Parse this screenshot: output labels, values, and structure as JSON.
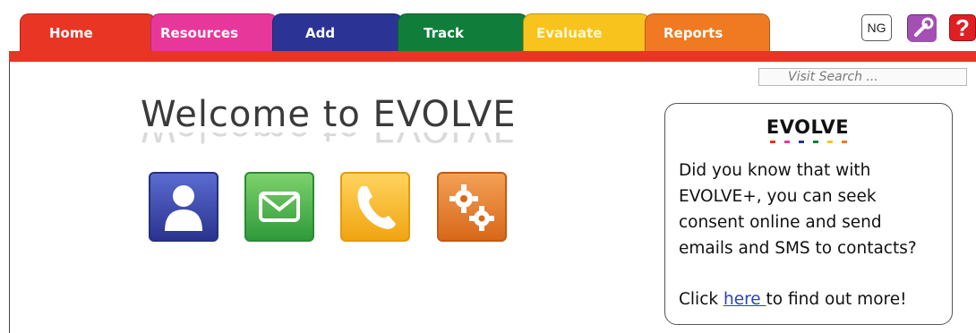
{
  "tabs": [
    {
      "id": "home",
      "label": "Home",
      "color": "#e83524"
    },
    {
      "id": "resources",
      "label": "Resources",
      "color": "#e8379a"
    },
    {
      "id": "add",
      "label": "Add",
      "color": "#2b3495"
    },
    {
      "id": "track",
      "label": "Track",
      "color": "#107e3a"
    },
    {
      "id": "evaluate",
      "label": "Evaluate",
      "color": "#f8c31d"
    },
    {
      "id": "reports",
      "label": "Reports",
      "color": "#f07a22"
    }
  ],
  "header": {
    "user_initials": "NG",
    "tools_icon": "wrench-icon",
    "help_label": "?"
  },
  "search": {
    "placeholder": "Visit Search ..."
  },
  "welcome": {
    "title": "Welcome to EVOLVE"
  },
  "app_icons": [
    "contacts-icon",
    "email-icon",
    "phone-icon",
    "settings-icon"
  ],
  "infobox": {
    "logo": "EVOLVE",
    "logo_dot_colors": [
      "#e83524",
      "#e8379a",
      "#2b3495",
      "#107e3a",
      "#f8c31d",
      "#f07a22"
    ],
    "line1": "Did you know that with",
    "line2": "EVOLVE+, you can seek",
    "line3": "consent online and send",
    "line4": "emails and SMS to contacts?",
    "cta_prefix": "Click ",
    "cta_link": "here ",
    "cta_suffix": "to find out more!"
  }
}
